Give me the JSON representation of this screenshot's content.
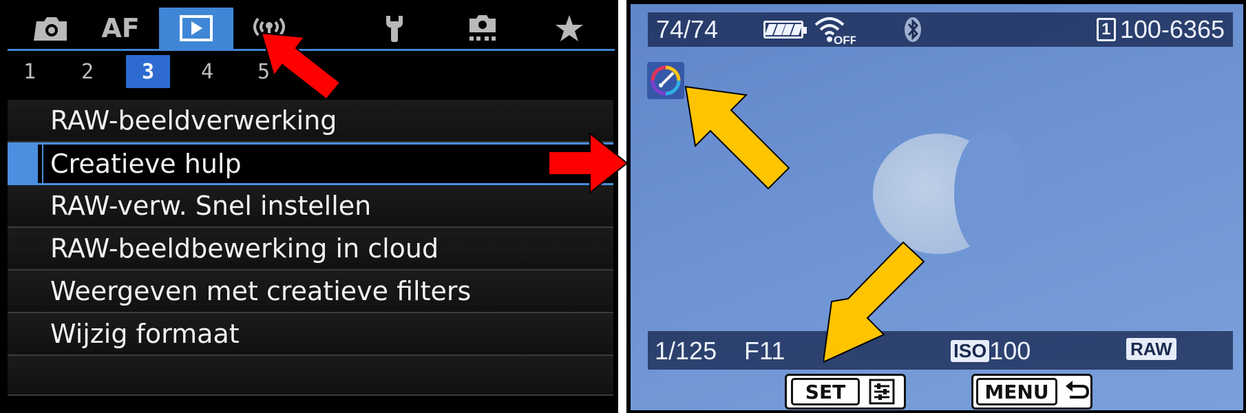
{
  "colors": {
    "accent_blue": "#3f86d6",
    "menu_bg": "#111111",
    "menu_text": "#f2f2f2",
    "screen_blue": "#6d93d3",
    "red_arrow": "#ff0000",
    "yellow_arrow": "#ffc400"
  },
  "menu_screen": {
    "tabs": [
      {
        "icon": "camera-icon",
        "label": ""
      },
      {
        "icon": "",
        "label": "AF"
      },
      {
        "icon": "playback-icon",
        "label": "",
        "active": true
      },
      {
        "icon": "wireless-icon",
        "label": ""
      },
      {
        "icon": "wrench-icon",
        "label": ""
      },
      {
        "icon": "custom-functions-icon",
        "label": ""
      },
      {
        "icon": "star-icon",
        "label": ""
      }
    ],
    "subtabs": [
      "1",
      "2",
      "3",
      "4",
      "5"
    ],
    "active_subtab": "3",
    "items": [
      "RAW-beeldverwerking",
      "Creatieve hulp",
      "RAW-verw. Snel instellen",
      "RAW-beeldbewerking in cloud",
      "Weergeven met creatieve filters",
      "Wijzig formaat"
    ],
    "selected_item": "Creatieve hulp"
  },
  "playback_screen": {
    "image_counter": "74/74",
    "battery_icon": "battery-full-icon",
    "wifi_status_icon": "wifi-off-icon",
    "wifi_status_text": "OFF",
    "bluetooth_icon": "bluetooth-icon",
    "card_slot": "1",
    "file_number": "100-6365",
    "creative_assist_icon": "creative-assist-icon",
    "shutter_speed": "1/125",
    "aperture": "F11",
    "iso_label": "ISO",
    "iso_value": "100",
    "image_quality": "RAW",
    "set_button_label": "SET",
    "set_button_icon": "quick-control-icon",
    "menu_button_label": "MENU",
    "menu_button_icon": "return-icon"
  }
}
